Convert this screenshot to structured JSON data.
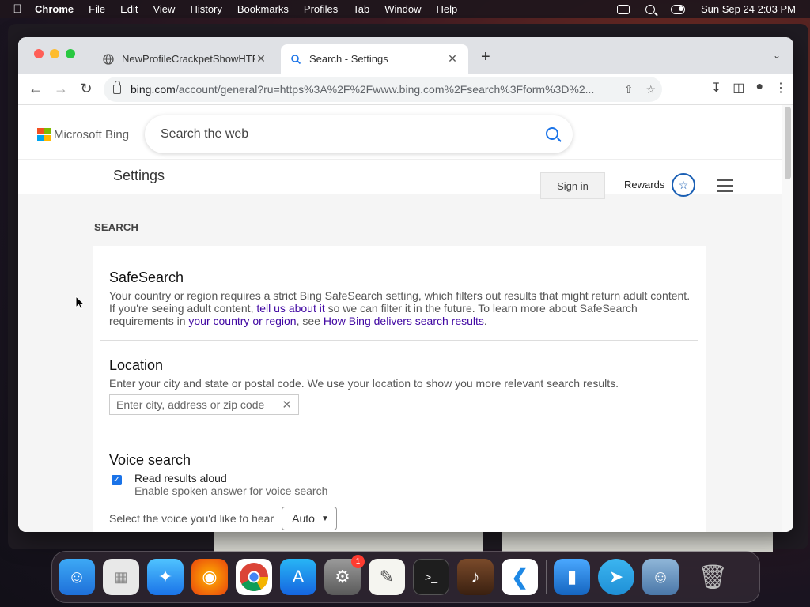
{
  "menubar": {
    "app": "Chrome",
    "items": [
      "File",
      "Edit",
      "View",
      "History",
      "Bookmarks",
      "Profiles",
      "Tab",
      "Window",
      "Help"
    ],
    "datetime": "Sun Sep 24  2:03 PM"
  },
  "browser": {
    "tabs": [
      {
        "title": "NewProfileCrackpetShowHTFR",
        "active": false
      },
      {
        "title": "Search - Settings",
        "active": true
      }
    ],
    "url_host": "bing.com",
    "url_path": "/account/general?ru=https%3A%2F%2Fwww.bing.com%2Fsearch%3Fform%3D%2..."
  },
  "bing": {
    "brand": "Microsoft Bing",
    "search_placeholder": "Search the web",
    "settings_title": "Settings",
    "signin_label": "Sign in",
    "rewards_label": "Rewards",
    "logo_colors": [
      "#f25022",
      "#7fba00",
      "#00a4ef",
      "#ffb900"
    ]
  },
  "settings": {
    "section_label": "SEARCH",
    "safesearch": {
      "title": "SafeSearch",
      "text1": "Your country or region requires a strict Bing SafeSearch setting, which filters out results that might return adult content. If you're seeing adult content, ",
      "link1": "tell us about it",
      "text2": " so we can filter it in the future. To learn more about SafeSearch requirements in ",
      "link2": "your country or region",
      "text3": ", see ",
      "link3": "How Bing delivers search results",
      "text4": "."
    },
    "location": {
      "title": "Location",
      "description": "Enter your city and state or postal code. We use your location to show you more relevant search results.",
      "placeholder": "Enter city, address or zip code"
    },
    "voice": {
      "title": "Voice search",
      "checkbox_label": "Read results aloud",
      "checkbox_sub": "Enable spoken answer for voice search",
      "checked": true,
      "voice_label": "Select the voice you'd like to hear",
      "voice_value": "Auto"
    }
  },
  "dock": {
    "apps": [
      "finder-icon",
      "launchpad-icon",
      "safari-icon",
      "firefox-icon",
      "chrome-icon",
      "app-store-icon",
      "system-settings-icon",
      "textedit-icon",
      "terminal-icon",
      "garageband-icon",
      "vscode-icon",
      "keynote-icon",
      "telegram-icon",
      "finder-icon",
      "trash-icon"
    ],
    "settings_badge": "1"
  }
}
